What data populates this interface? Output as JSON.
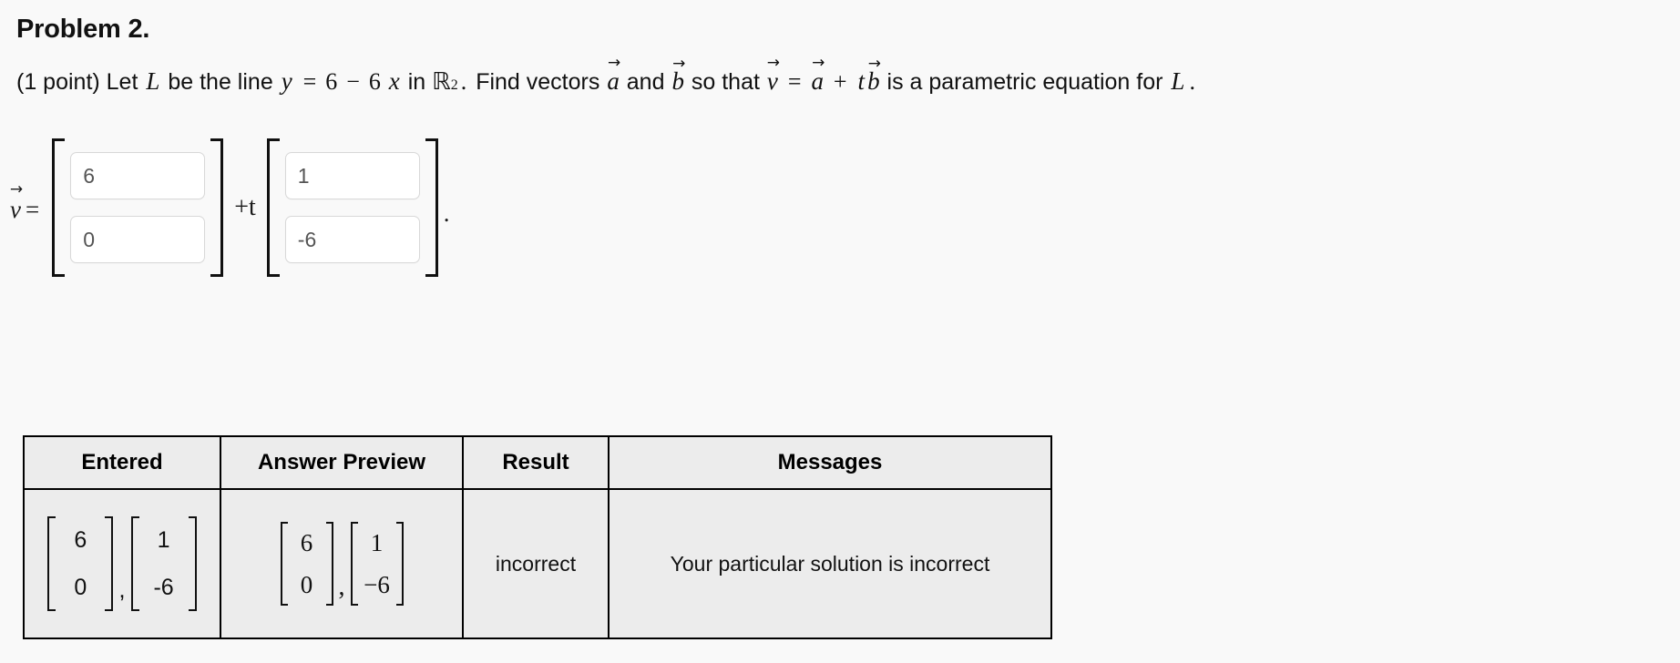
{
  "problem": {
    "title": "Problem 2.",
    "points_label": "(1 point)",
    "statement": {
      "lead": "(1 point) Let",
      "line_var": "L",
      "be_the_line": "be the line",
      "eq_lhs": "y",
      "eq_sign": "=",
      "eq_rhs_num": "6",
      "eq_minus": "−",
      "eq_coef": "6",
      "eq_x": "x",
      "in_word": "in",
      "space_symbol": "ℝ",
      "space_exponent": "2",
      "period_after_space": ".",
      "find_vectors": "Find vectors",
      "vec_a": "a",
      "and_word": "and",
      "vec_b": "b",
      "so_that": "so that",
      "vec_v": "v",
      "assign": "=",
      "plus": "+",
      "t_var": "t",
      "tail": "is a parametric equation for",
      "final_var": "L",
      "final_period": "."
    }
  },
  "answer_entry": {
    "v_symbol": "v",
    "equals": "=",
    "plus_t": "+t",
    "trailing_period": ".",
    "vector_a": {
      "row1_value": "6",
      "row2_value": "0",
      "row1_placeholder": "",
      "row2_placeholder": ""
    },
    "vector_b": {
      "row1_value": "1",
      "row2_value": "-6",
      "row1_placeholder": "",
      "row2_placeholder": ""
    }
  },
  "results": {
    "headers": [
      "Entered",
      "Answer Preview",
      "Result",
      "Messages"
    ],
    "row": {
      "entered": {
        "matrix_a": [
          "6",
          "0"
        ],
        "separator": ",",
        "matrix_b": [
          "1",
          "-6"
        ]
      },
      "answer_preview": {
        "matrix_a": [
          "6",
          "0"
        ],
        "separator": ",",
        "matrix_b": [
          "1",
          "−6"
        ]
      },
      "result": "incorrect",
      "message": "Your particular solution is incorrect"
    }
  },
  "colors": {
    "page_background": "#f9f9f9",
    "table_cell_background": "#ececec",
    "table_border": "#000000",
    "input_border": "#d8d8d8",
    "input_text": "#555555",
    "text": "#111111"
  }
}
